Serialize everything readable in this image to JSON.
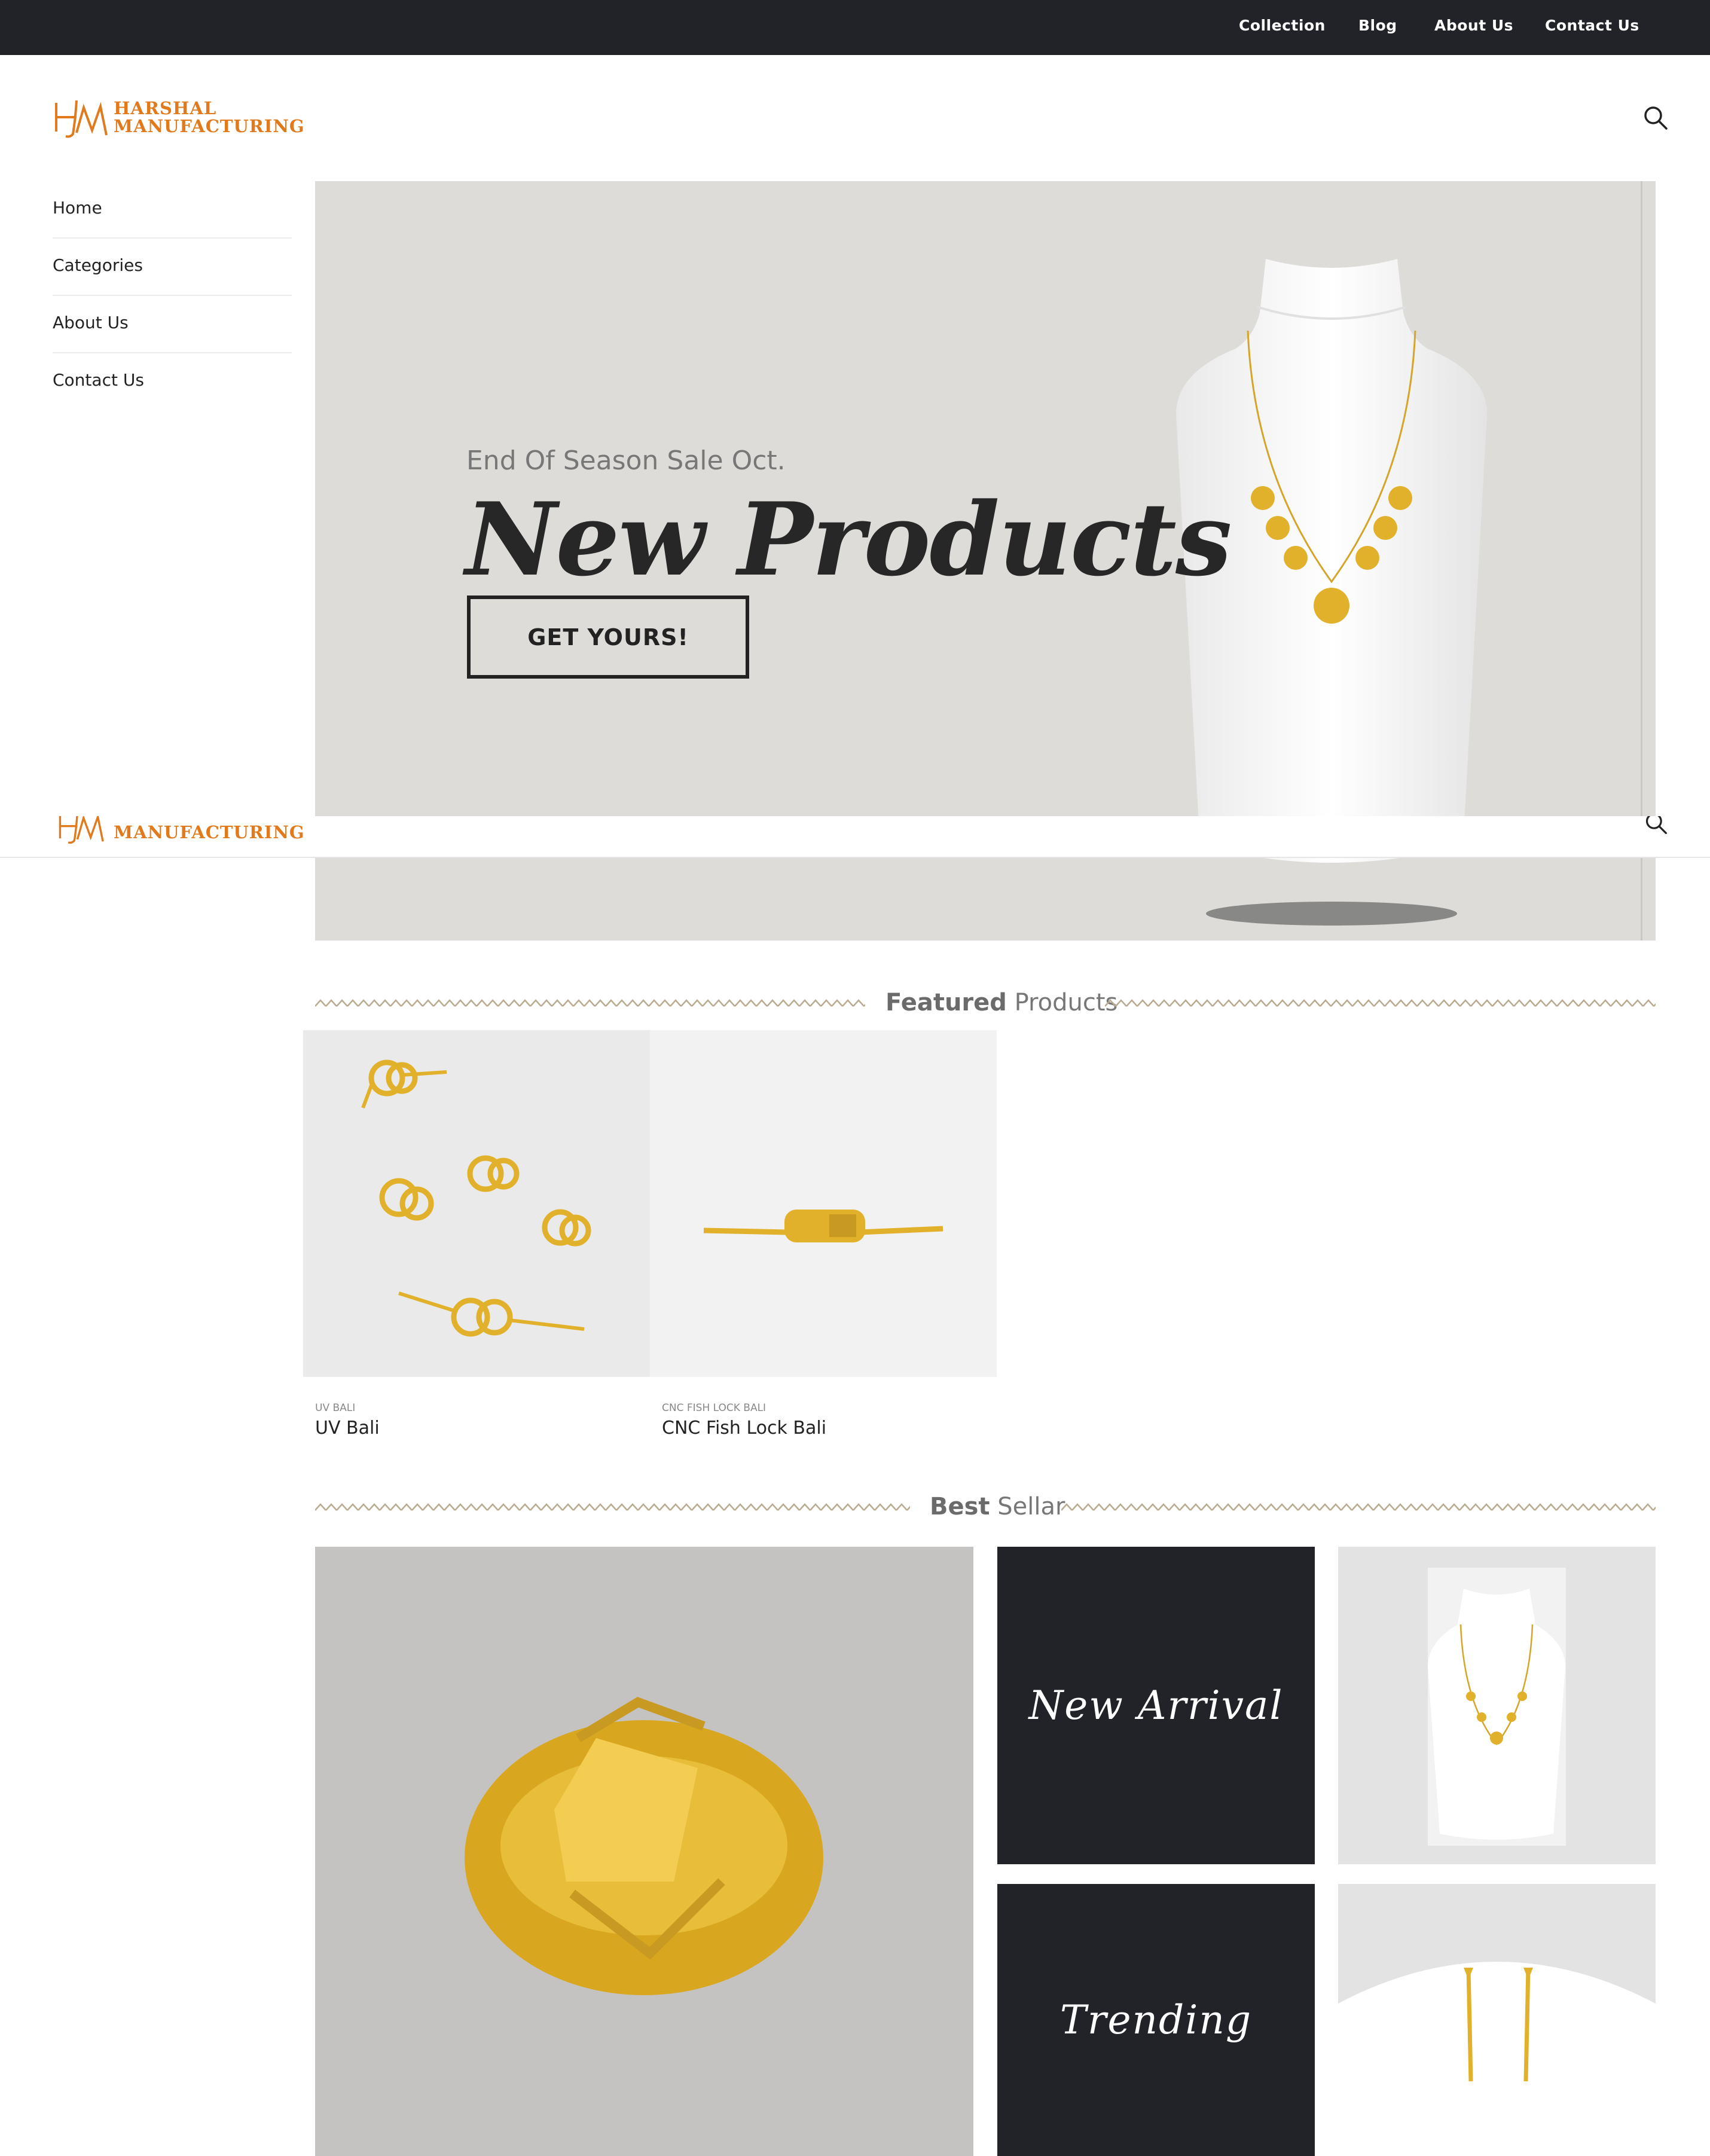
{
  "topnav": {
    "items": [
      "Collection",
      "Blog",
      "About Us",
      "Contact Us"
    ]
  },
  "brand": {
    "line1": "HARSHAL",
    "line2": "MANUFACTURING",
    "color": "#e07a1c"
  },
  "sidebar": {
    "items": [
      "Home",
      "Categories",
      "About Us",
      "Contact Us"
    ]
  },
  "hero": {
    "subtitle": "End Of Season Sale Oct.",
    "title": "New Products",
    "button": "GET YOURS!"
  },
  "featured": {
    "title_bold": "Featured",
    "title_rest": " Products",
    "products": [
      {
        "category": "UV BALI",
        "name": "UV Bali"
      },
      {
        "category": "CNC FISH LOCK BALI",
        "name": "CNC Fish Lock Bali"
      }
    ]
  },
  "bestseller": {
    "title_bold": "Best",
    "title_rest": " Sellar",
    "tiles": [
      "New Arrival",
      "Trending"
    ]
  },
  "icons": {
    "search": "search-icon"
  },
  "colors": {
    "topbar_bg": "#212329",
    "hero_bg": "#dddcd8",
    "accent_gold": "#e2b12b"
  }
}
